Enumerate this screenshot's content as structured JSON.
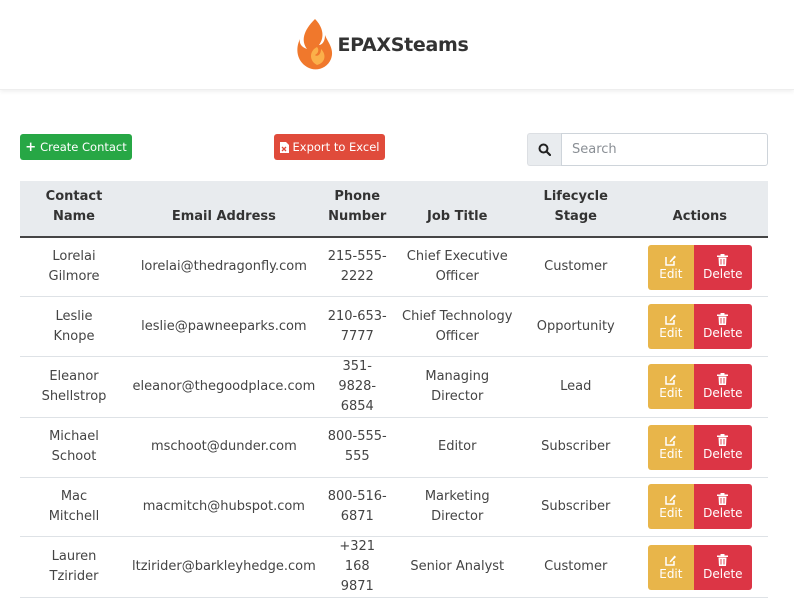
{
  "brand": {
    "name": "EPAXSteams",
    "accent": "#f0782c"
  },
  "toolbar": {
    "create_label": "Create Contact",
    "export_label": "Export to Excel",
    "search_placeholder": "Search",
    "search_value": ""
  },
  "table": {
    "headers": [
      "Contact Name",
      "Email Address",
      "Phone Number",
      "Job Title",
      "Lifecycle Stage",
      "Actions"
    ],
    "edit_label": "Edit",
    "delete_label": "Delete",
    "rows": [
      {
        "name": "Lorelai Gilmore",
        "email": "lorelai@thedragonfly.com",
        "phone": "215-555-2222",
        "job": "Chief Executive Officer",
        "stage": "Customer"
      },
      {
        "name": "Leslie Knope",
        "email": "leslie@pawneeparks.com",
        "phone": "210-653-7777",
        "job": "Chief Technology Officer",
        "stage": "Opportunity"
      },
      {
        "name": "Eleanor Shellstrop",
        "email": "eleanor@thegoodplace.com",
        "phone": "351-9828-6854",
        "job": "Managing Director",
        "stage": "Lead"
      },
      {
        "name": "Michael Schoot",
        "email": "mschoot@dunder.com",
        "phone": "800-555-555",
        "job": "Editor",
        "stage": "Subscriber"
      },
      {
        "name": "Mac Mitchell",
        "email": "macmitch@hubspot.com",
        "phone": "800-516-6871",
        "job": "Marketing Director",
        "stage": "Subscriber"
      },
      {
        "name": "Lauren Tzirider",
        "email": "ltzirider@barkleyhedge.com",
        "phone": "+321 168 9871",
        "job": "Senior Analyst",
        "stage": "Customer"
      }
    ]
  },
  "colors": {
    "create": "#27a745",
    "export": "#e04b3b",
    "edit": "#e8b54a",
    "delete": "#dc3545"
  },
  "icons": {
    "create": "plus-icon",
    "export": "file-excel-icon",
    "search": "search-icon",
    "edit": "edit-icon",
    "delete": "trash-icon",
    "logo": "flame-icon"
  }
}
